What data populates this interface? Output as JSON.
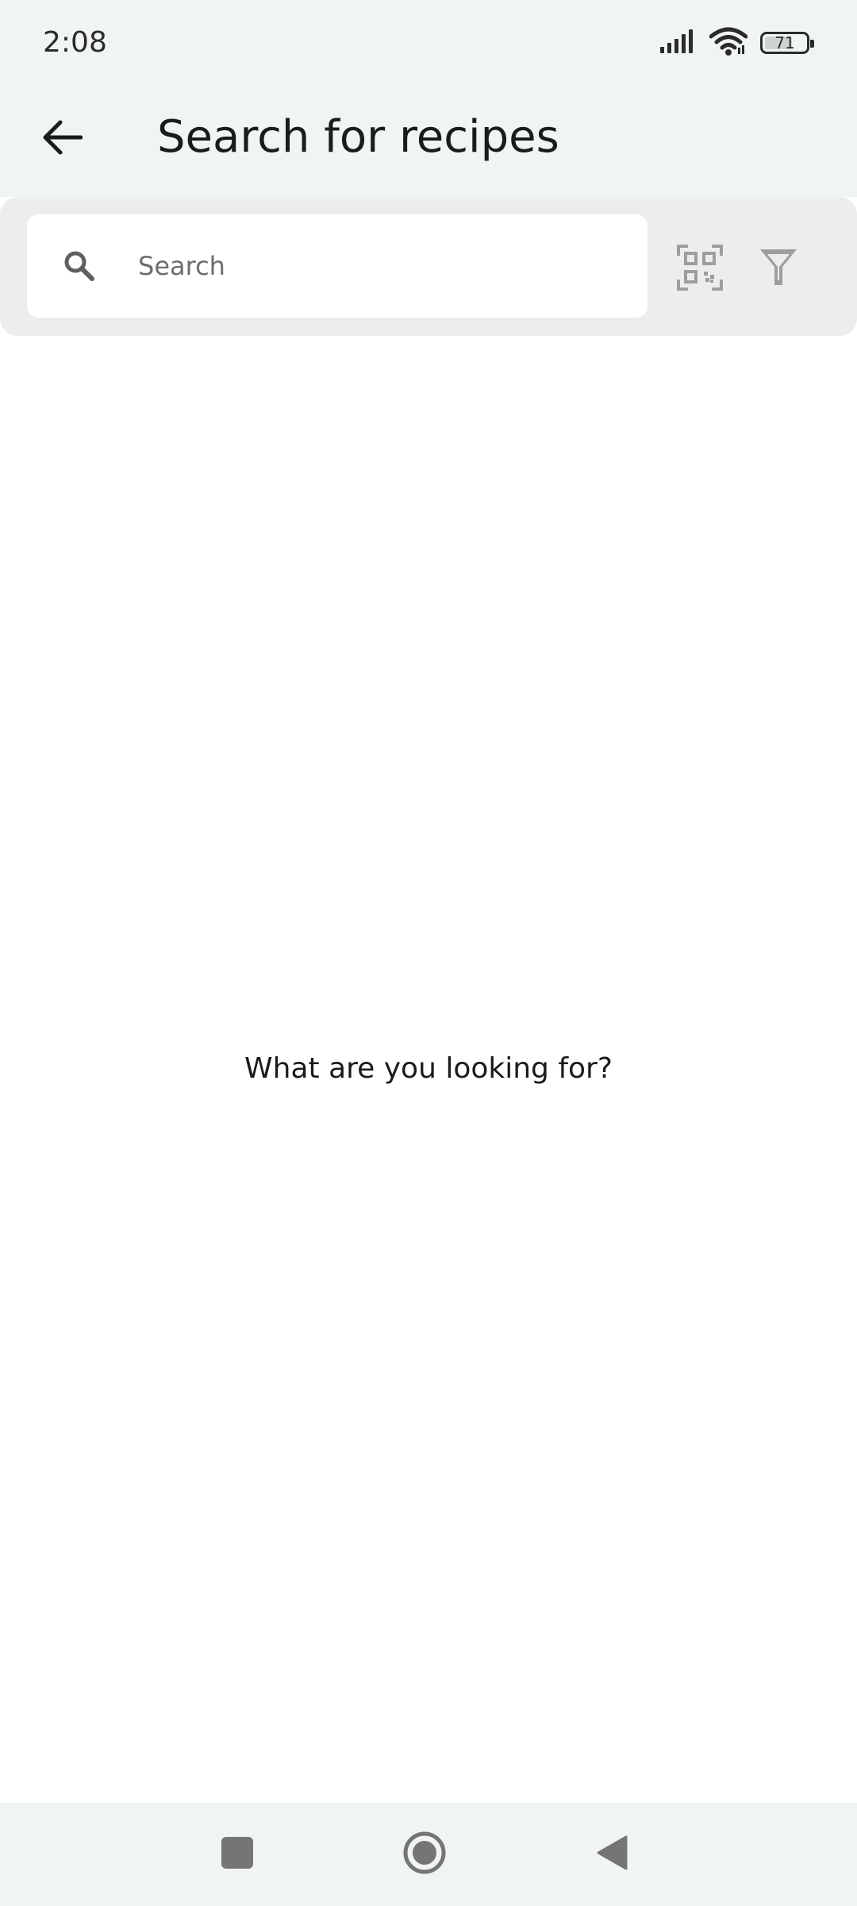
{
  "status_bar": {
    "time": "2:08",
    "battery_level": "71",
    "battery_fraction": 0.71,
    "icons": [
      "signal-icon",
      "wifi-icon",
      "battery-icon"
    ]
  },
  "app_bar": {
    "title": "Search for recipes",
    "back_icon": "arrow-back-icon"
  },
  "search": {
    "value": "",
    "placeholder": "Search",
    "icon": "search-icon",
    "scan_icon": "qr-scan-icon",
    "filter_icon": "filter-icon"
  },
  "empty_state": {
    "message": "What are you looking for?"
  },
  "nav_bar": {
    "buttons": [
      "recents-icon",
      "home-icon",
      "back-triangle-icon"
    ]
  },
  "colors": {
    "bar_background": "#f1f5f1",
    "search_panel": "#ededed",
    "icon_gray": "#9e9e9e",
    "text_dark": "#1a1c1a"
  }
}
